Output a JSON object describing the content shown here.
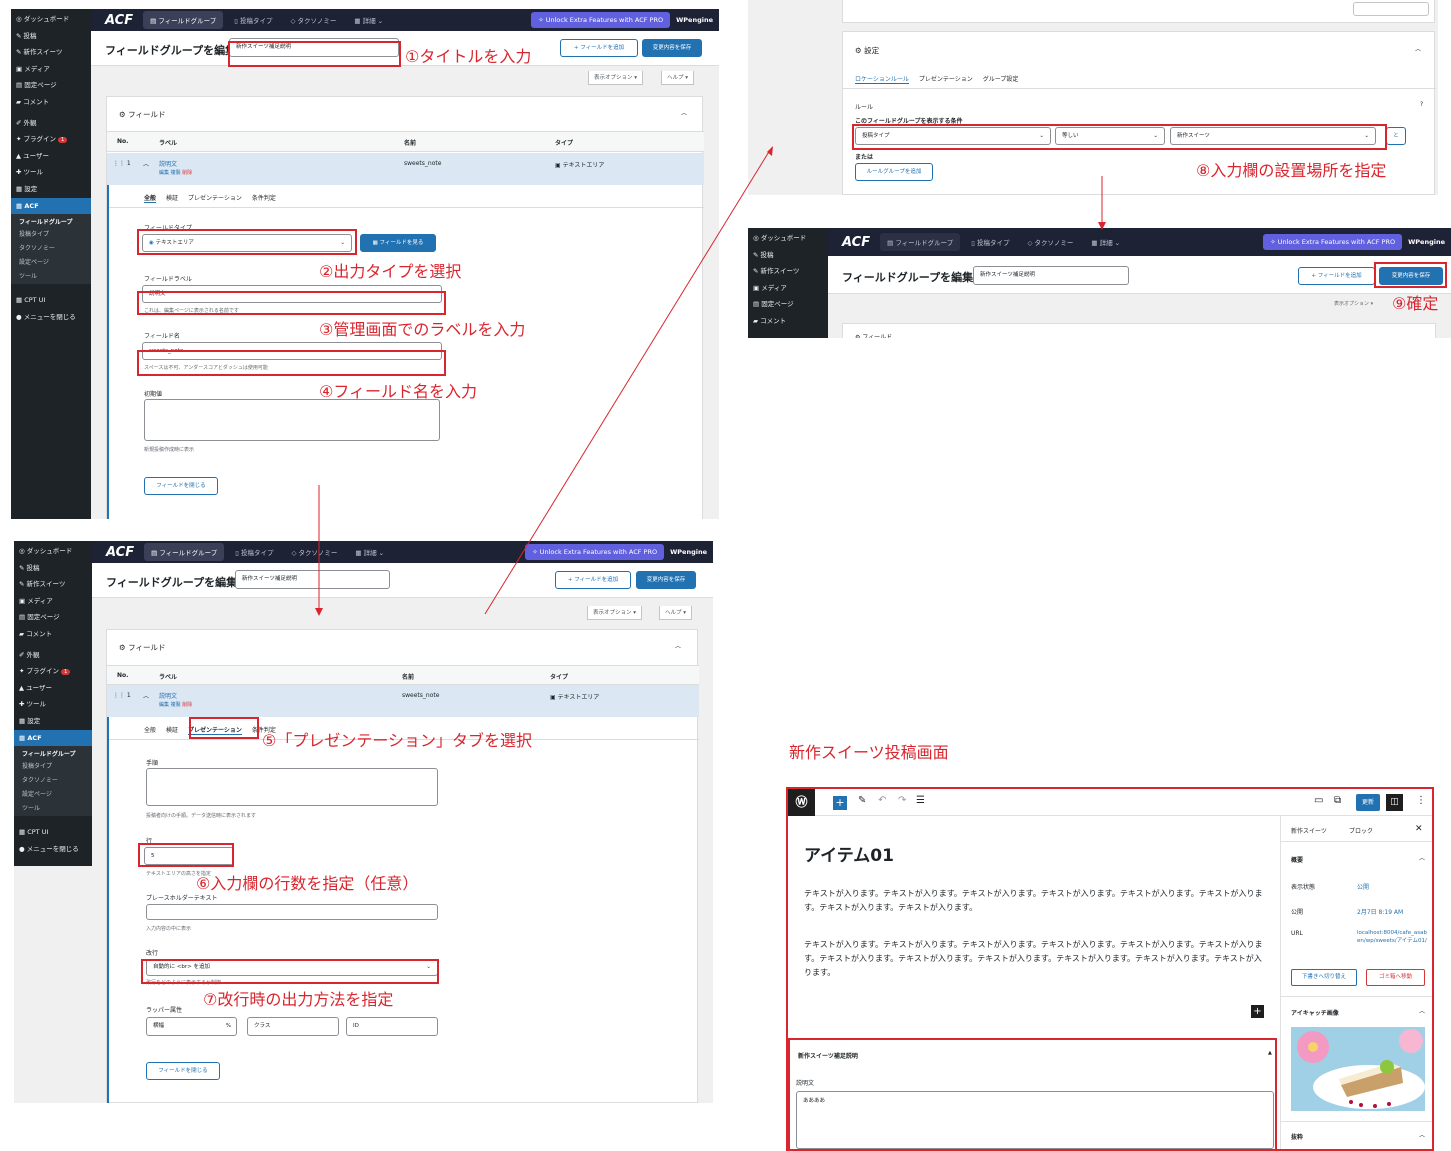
{
  "sidebar": {
    "items": [
      "ダッシュボード",
      "投稿",
      "新作スイーツ",
      "メディア",
      "固定ページ",
      "コメント",
      "外観",
      "プラグイン",
      "ユーザー",
      "ツール",
      "設定",
      "ACF"
    ],
    "acf_sub": [
      "フィールドグループ",
      "投稿タイプ",
      "タクソノミー",
      "設定ページ",
      "ツール"
    ],
    "cpt": "CPT UI",
    "collapse": "メニューを閉じる",
    "plugin_badge": "1"
  },
  "topbar": {
    "logo": "ACF",
    "field_groups": "フィールドグループ",
    "post_types": "投稿タイプ",
    "taxonomies": "タクソノミー",
    "more": "詳細",
    "pro": "Unlock Extra Features with ACF PRO",
    "wpengine": "WPengine"
  },
  "header": {
    "title": "フィールドグループを編集",
    "group_name": "新作スイーツ補足説明",
    "add_field": "+ フィールドを追加",
    "save": "変更内容を保存",
    "screen_options": "表示オプション ▾",
    "help": "ヘルプ ▾"
  },
  "fields_box": {
    "title": "フィールド",
    "col_no": "No.",
    "col_label": "ラベル",
    "col_name": "名前",
    "col_type": "タイプ",
    "row_no": "1",
    "row_label": "説明文",
    "row_actions_edit": "編集",
    "row_actions_dup": "複製",
    "row_actions_del": "削除",
    "row_name": "sweets_note",
    "row_type": "テキストエリア"
  },
  "tabs": [
    "全般",
    "検証",
    "プレゼンテーション",
    "条件判定"
  ],
  "general": {
    "field_type_label": "フィールドタイプ",
    "field_type_value": "テキストエリア",
    "browse_fields": "フィールドを見る",
    "field_label_label": "フィールドラベル",
    "field_label_value": "説明文",
    "field_label_help": "これは、編集ページに表示される名前です",
    "field_name_label": "フィールド名",
    "field_name_value": "sweets_note",
    "field_name_help": "スペースは不可、アンダースコアとダッシュは使用可能",
    "default_label": "初期値",
    "default_help": "新規投稿作成時に表示",
    "close_field": "フィールドを閉じる"
  },
  "presentation": {
    "instructions_label": "手順",
    "instructions_help": "投稿者向けの手順。データ送信時に表示されます",
    "rows_label": "行",
    "rows_value": "5",
    "rows_help": "テキストエリアの高さを指定",
    "placeholder_label": "プレースホルダーテキスト",
    "placeholder_help": "入力内容の中に表示",
    "newlines_label": "改行",
    "newlines_value": "自動的に <br> を追加",
    "newlines_help": "改行をどのように表示するか制御",
    "wrapper_label": "ラッパー属性",
    "wrapper_width": "横幅",
    "wrapper_pct": "%",
    "wrapper_class": "クラス",
    "wrapper_id": "ID",
    "close_field": "フィールドを閉じる"
  },
  "settings": {
    "title": "設定",
    "tabs": [
      "ロケーションルール",
      "プレゼンテーション",
      "グループ設定"
    ],
    "rules": "ルール",
    "show_if": "このフィールドグループを表示する条件",
    "param": "投稿タイプ",
    "operator": "等しい",
    "value": "新作スイーツ",
    "and": "と",
    "or": "または",
    "add_group": "ルールグループを追加"
  },
  "annotations": {
    "a1": "①タイトルを入力",
    "a2": "②出力タイプを選択",
    "a3": "③管理画面でのラベルを入力",
    "a4": "④フィールド名を入力",
    "a5": "⑤「プレゼンテーション」タブを選択",
    "a6": "⑥入力欄の行数を指定（任意）",
    "a7": "⑦改行時の出力方法を指定",
    "a8": "⑧入力欄の設置場所を指定",
    "a9": "⑨確定",
    "editor_caption": "新作スイーツ投稿画面"
  },
  "editor": {
    "update": "更新",
    "post_title": "アイテム01",
    "para1": "テキストが入ります。テキストが入ります。テキストが入ります。テキストが入ります。テキストが入ります。テキストが入ります。テキストが入ります。テキストが入ります。",
    "para2": "テキストが入ります。テキストが入ります。テキストが入ります。テキストが入ります。テキストが入ります。テキストが入ります。テキストが入ります。テキストが入ります。テキストが入ります。テキストが入ります。テキストが入ります。テキストが入ります。",
    "meta_title": "新作スイーツ補足説明",
    "meta_label": "説明文",
    "meta_value": "ああああ",
    "side_tab_post": "新作スイーツ",
    "side_tab_block": "ブロック",
    "summary": "概要",
    "visibility_label": "表示状態",
    "visibility_value": "公開",
    "publish_label": "公開",
    "publish_value": "2月7日 8:19 AM",
    "url_label": "URL",
    "url_value": "localhost:8004/cafe_asaben/wp/sweets/アイテム01/",
    "draft_btn": "下書きへ切り替え",
    "trash_btn": "ゴミ箱へ移動",
    "featured": "アイキャッチ画像",
    "excerpt": "抜粋"
  }
}
